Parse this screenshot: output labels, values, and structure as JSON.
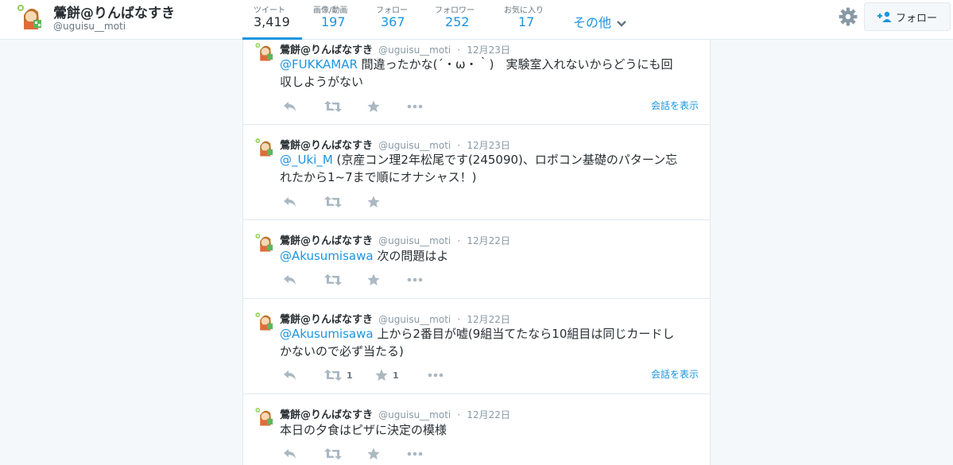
{
  "profile": {
    "name": "鶯餅@りんばなすき",
    "handle": "@uguisu__moti"
  },
  "stats": [
    {
      "label": "ツイート",
      "value": "3,419"
    },
    {
      "label": "画像/動画",
      "value": "197"
    },
    {
      "label": "フォロー",
      "value": "367"
    },
    {
      "label": "フォロワー",
      "value": "252"
    },
    {
      "label": "お気に入り",
      "value": "17"
    }
  ],
  "more_label": "その他",
  "follow_label": "フォロー",
  "icons": {
    "gear": "gear-icon",
    "follow": "person-add-icon",
    "reply": "reply-icon",
    "retweet": "retweet-icon",
    "favorite": "star-icon",
    "more": "more-dots-icon",
    "chevron": "chevron-down-icon"
  },
  "colors": {
    "accent": "#1b95e0",
    "text": "#292f33",
    "muted": "#8899a6",
    "icon": "#aab8c2"
  },
  "tweets": [
    {
      "name": "鶯餅@りんばなすき",
      "handle": "@uguisu__moti",
      "time": "12月23日",
      "mention": "@FUKKAMAR",
      "text": " 間違ったかな(´・ω・｀)　実験室入れないからどうにも回",
      "text2": "収しようがない",
      "retweet_count": "",
      "favorite_count": "",
      "conversation": "会話を表示"
    },
    {
      "name": "鶯餅@りんばなすき",
      "handle": "@uguisu__moti",
      "time": "12月23日",
      "mention": "@_Uki_M",
      "text": " (京産コン理2年松尾です(245090)、ロボコン基礎のパターン忘",
      "text2": "れたから1~7まで順にオナシャス！)",
      "retweet_count": "",
      "favorite_count": "",
      "conversation": ""
    },
    {
      "name": "鶯餅@りんばなすき",
      "handle": "@uguisu__moti",
      "time": "12月22日",
      "mention": "@Akusumisawa",
      "text": " 次の問題はよ",
      "text2": "",
      "retweet_count": "",
      "favorite_count": "",
      "conversation": ""
    },
    {
      "name": "鶯餅@りんばなすき",
      "handle": "@uguisu__moti",
      "time": "12月22日",
      "mention": "@Akusumisawa",
      "text": " 上から2番目が嘘(9組当てたなら10組目は同じカードし",
      "text2": "かないので必ず当たる)",
      "retweet_count": "1",
      "favorite_count": "1",
      "conversation": "会話を表示"
    },
    {
      "name": "鶯餅@りんばなすき",
      "handle": "@uguisu__moti",
      "time": "12月22日",
      "mention": "",
      "text": "本日の夕食はピザに決定の模様",
      "text2": "",
      "retweet_count": "",
      "favorite_count": "",
      "conversation": ""
    }
  ]
}
